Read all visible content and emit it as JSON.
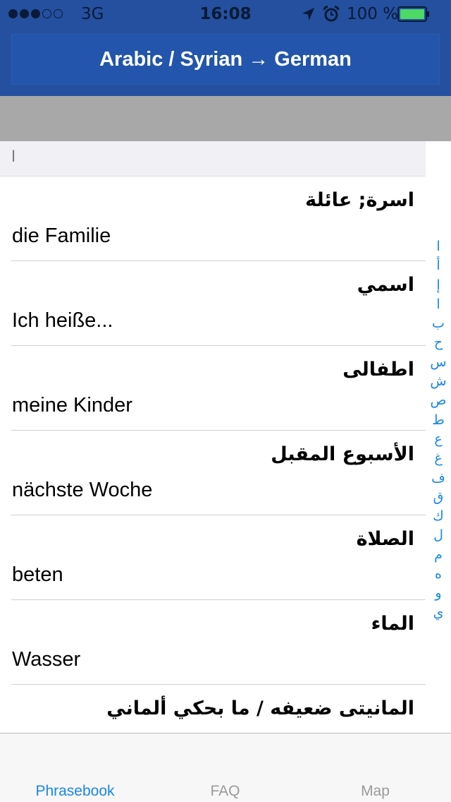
{
  "status_bar": {
    "carrier": "3G",
    "time": "16:08",
    "battery_percent": "100 %",
    "signal_bars_filled": 3,
    "signal_bars_total": 5,
    "battery_level": 1.0,
    "icons": [
      "location-arrow-icon",
      "alarm-clock-icon",
      "battery-icon"
    ]
  },
  "header": {
    "title": "Arabic / Syrian → German"
  },
  "section": {
    "letter": "ا"
  },
  "phrases": [
    {
      "arabic": "اسرة; عائلة",
      "german": "die Familie"
    },
    {
      "arabic": "اسمي",
      "german": "Ich heiße..."
    },
    {
      "arabic": "اطفالى",
      "german": "meine Kinder"
    },
    {
      "arabic": "الأسبوع المقبل",
      "german": "nächste Woche"
    },
    {
      "arabic": "الصلاة",
      "german": "beten"
    },
    {
      "arabic": "الماء",
      "german": "Wasser"
    },
    {
      "arabic": "المانيتى ضعيفه / ما بحكي ألماني",
      "german": ""
    }
  ],
  "alphabet_index": [
    "ا",
    "أ",
    "إ",
    "ا",
    "ب",
    "ح",
    "س",
    "ش",
    "ص",
    "ط",
    "ع",
    "غ",
    "ف",
    "ق",
    "ك",
    "ل",
    "م",
    "ه",
    "و",
    "ي"
  ],
  "tabs": [
    {
      "label": "Phrasebook",
      "active": true
    },
    {
      "label": "FAQ",
      "active": false
    },
    {
      "label": "Map",
      "active": false
    }
  ],
  "colors": {
    "header_bg": "#24509f",
    "title_bar_bg": "#2255ab",
    "search_band": "#a8a8a8",
    "accent": "#1a87e6",
    "battery_green": "#4cd964"
  }
}
